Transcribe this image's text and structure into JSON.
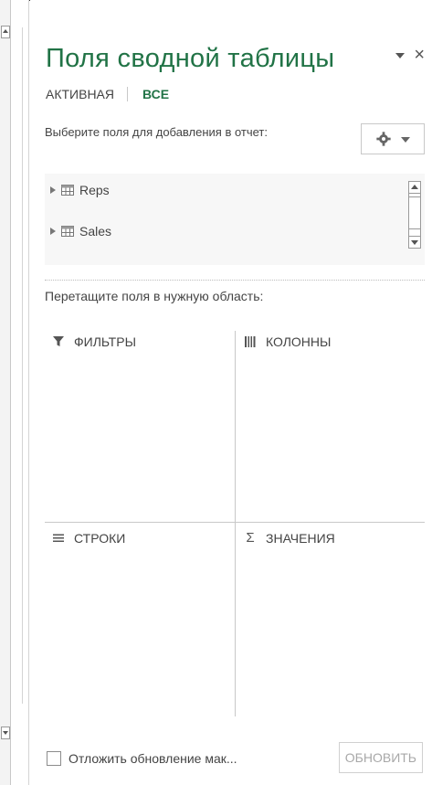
{
  "pane": {
    "title": "Поля сводной таблицы",
    "tabs": {
      "active": "АКТИВНАЯ",
      "all": "ВСЕ"
    },
    "choose_fields_label": "Выберите поля для добавления в отчет:",
    "fields": [
      "Reps",
      "Sales"
    ],
    "drag_label": "Перетащите поля в нужную область:",
    "areas": {
      "filters": "ФИЛЬТРЫ",
      "columns": "КОЛОННЫ",
      "rows": "СТРОКИ",
      "values": "ЗНАЧЕНИЯ"
    },
    "footer": {
      "defer_label": "Отложить обновление мак...",
      "update_button": "ОБНОВИТЬ"
    }
  },
  "colors": {
    "accent": "#217346",
    "text": "#444444",
    "border": "#c8c8c8",
    "disabled_text": "#a8a8a8"
  },
  "icons": {
    "menu": "chevron-down-icon",
    "close": "close-icon",
    "settings": "gear-icon",
    "table": "table-icon",
    "filter": "filter-icon",
    "columns": "columns-icon",
    "rows": "rows-icon",
    "values": "sigma-icon"
  }
}
